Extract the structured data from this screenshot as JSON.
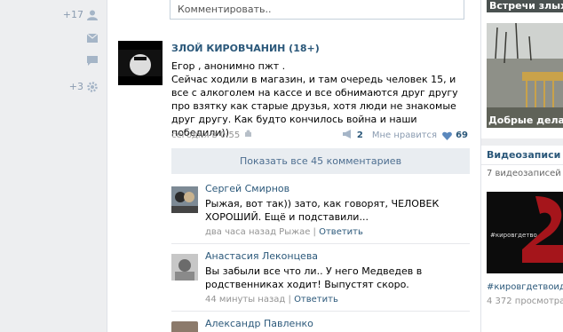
{
  "left_counters": [
    {
      "label": "+17",
      "icon": "person-icon"
    },
    {
      "label": "",
      "icon": "mail-icon"
    },
    {
      "label": "",
      "icon": "chat-icon"
    },
    {
      "label": "+3",
      "icon": "gear-icon"
    }
  ],
  "comment_input": {
    "placeholder": "Комментировать.."
  },
  "post": {
    "author": "ЗЛОЙ КИРОВЧАНИН (18+)",
    "text": "Егор , анонимно пжт .\nСейчас ходили в магазин, и там очередь человек 15, и все с алкоголем на кассе и все обнимаются друг другу про взятку как старые друзья, хотя люди не знакомые друг другу. Как будто кончилось война и наши победили))",
    "time": "сегодня в 0:55",
    "reposts": "2",
    "like_label": "Мне нравится",
    "likes": "69",
    "avatar_text": "злой кировчанин"
  },
  "show_all": "Показать все 45 комментариев",
  "comments": [
    {
      "name": "Сергей Смирнов",
      "text": "Рыжая, вот так)) зато, как говорят, ЧЕЛОВЕК ХОРОШИЙ. Ещё и подставили...",
      "time": "два часа назад Рыжае",
      "reply": "Ответить"
    },
    {
      "name": "Анастасия Леконцева",
      "text": "Вы забыли все что ли.. У него Медведев в родственниках ходит! Выпустят скоро.",
      "time": "44 минуты назад",
      "reply": "Ответить"
    },
    {
      "name": "Александр Павленко",
      "text": "",
      "time": "",
      "reply": ""
    }
  ],
  "right": {
    "photo1_caption": "Встречи злых",
    "photo2_caption": "Добрые дела",
    "videos_title": "Видеозаписи",
    "videos_count": "7 видеозаписей",
    "video_tag": "#кировгдетво",
    "video_title": "#кировгдетвоиде",
    "video_views": "4 372 просмотра"
  },
  "colors": {
    "link": "#2b587a",
    "bg": "#edeef0",
    "meta": "#939393"
  }
}
